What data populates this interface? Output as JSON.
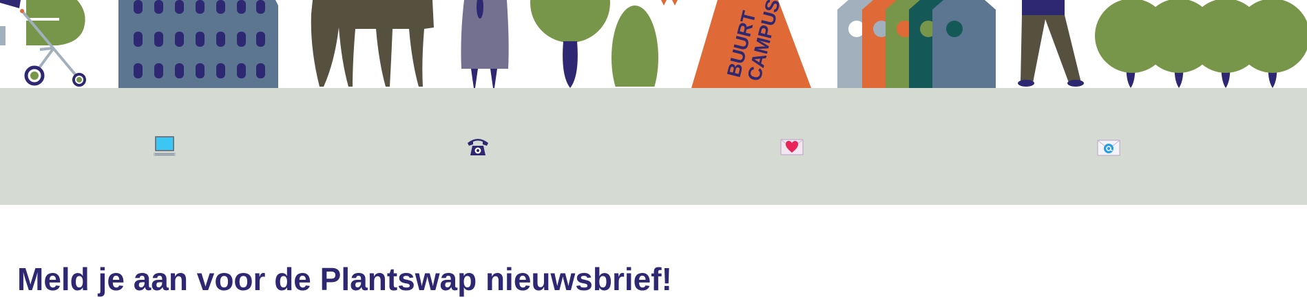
{
  "banner": {
    "tent_text_line1": "BUURT",
    "tent_text_line2": "CAMPUS"
  },
  "contact_bar": {
    "items": [
      {
        "name": "computer-icon"
      },
      {
        "name": "telephone-icon"
      },
      {
        "name": "love-letter-icon"
      },
      {
        "name": "email-icon"
      }
    ]
  },
  "newsletter": {
    "heading": "Meld je aan voor de Plantswap nieuwsbrief!"
  },
  "colors": {
    "navy": "#2e2872",
    "slate_blue": "#5c7591",
    "olive_green": "#789649",
    "dark_olive": "#56503f",
    "orange": "#e06a37",
    "teal": "#155858",
    "grey_blue": "#a2afbc",
    "purple_grey": "#737090",
    "bar_grey": "#d5dad3"
  }
}
